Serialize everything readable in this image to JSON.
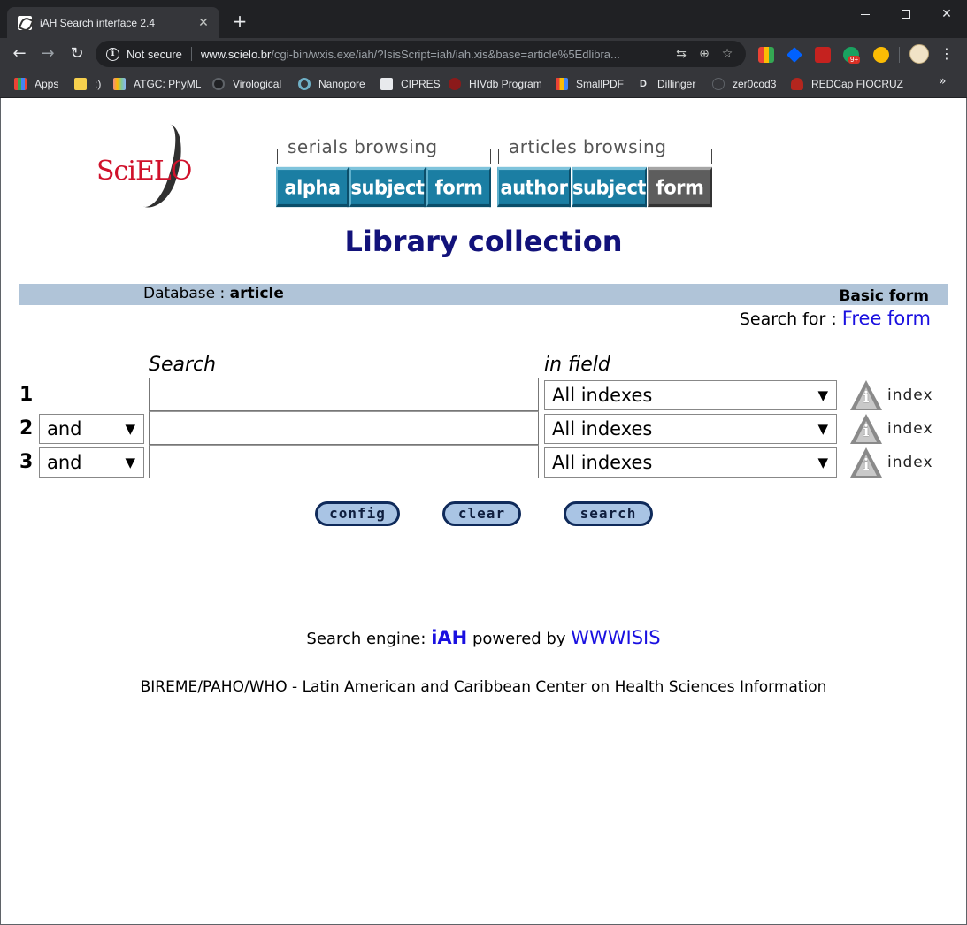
{
  "browser": {
    "tab_title": "iAH Search interface 2.4",
    "tab_close": "✕",
    "new_tab": "+",
    "security_label": "Not secure",
    "url_host": "www.scielo.br",
    "url_path": "/cgi-bin/wxis.exe/iah/?IsisScript=iah/iah.xis&base=article%5Edlibra...",
    "bookmarks": [
      "Apps",
      ":)",
      "ATGC: PhyML",
      "Virological",
      "Nanopore",
      "CIPRES",
      "HIVdb Program",
      "SmallPDF",
      "Dillinger",
      "zer0cod3",
      "REDCap FIOCRUZ"
    ],
    "bookmarks_more": "»",
    "ext_badge": "9+",
    "colors": {
      "chrome_dark": "#202124",
      "chrome_toolbar": "#35363a"
    }
  },
  "page": {
    "logo_text": "SciELO",
    "serials": {
      "caption": "serials browsing",
      "buttons": [
        "alpha",
        "subject",
        "form"
      ]
    },
    "articles": {
      "caption": "articles browsing",
      "buttons": [
        "author",
        "subject",
        "form"
      ]
    },
    "title": "Library collection",
    "db_label": "Database :",
    "db_value": "article",
    "form_type": "Basic form",
    "search_for_label": "Search for :",
    "search_for_link": "Free form",
    "col_search": "Search",
    "col_field": "in field",
    "rows": [
      {
        "num": "1",
        "operator": "",
        "term": "",
        "field": "All indexes",
        "index_label": "index"
      },
      {
        "num": "2",
        "operator": "and",
        "term": "",
        "field": "All indexes",
        "index_label": "index"
      },
      {
        "num": "3",
        "operator": "and",
        "term": "",
        "field": "All indexes",
        "index_label": "index"
      }
    ],
    "buttons": {
      "config": "config",
      "clear": "clear",
      "search": "search"
    },
    "footer": {
      "engine_prefix": "Search engine:",
      "engine_name": "iAH",
      "powered_by": "powered by",
      "powered_name": "WWWISIS",
      "bireme": "BIREME/PAHO/WHO - Latin American and Caribbean Center on Health Sciences Information"
    },
    "colors": {
      "title": "#12127a",
      "nav_button": "#1b7ea3",
      "nav_button_active": "#5d5d5d",
      "db_bar": "#b0c4d8",
      "link": "#1a10e0",
      "pill_fill": "#a9c4e4"
    }
  }
}
